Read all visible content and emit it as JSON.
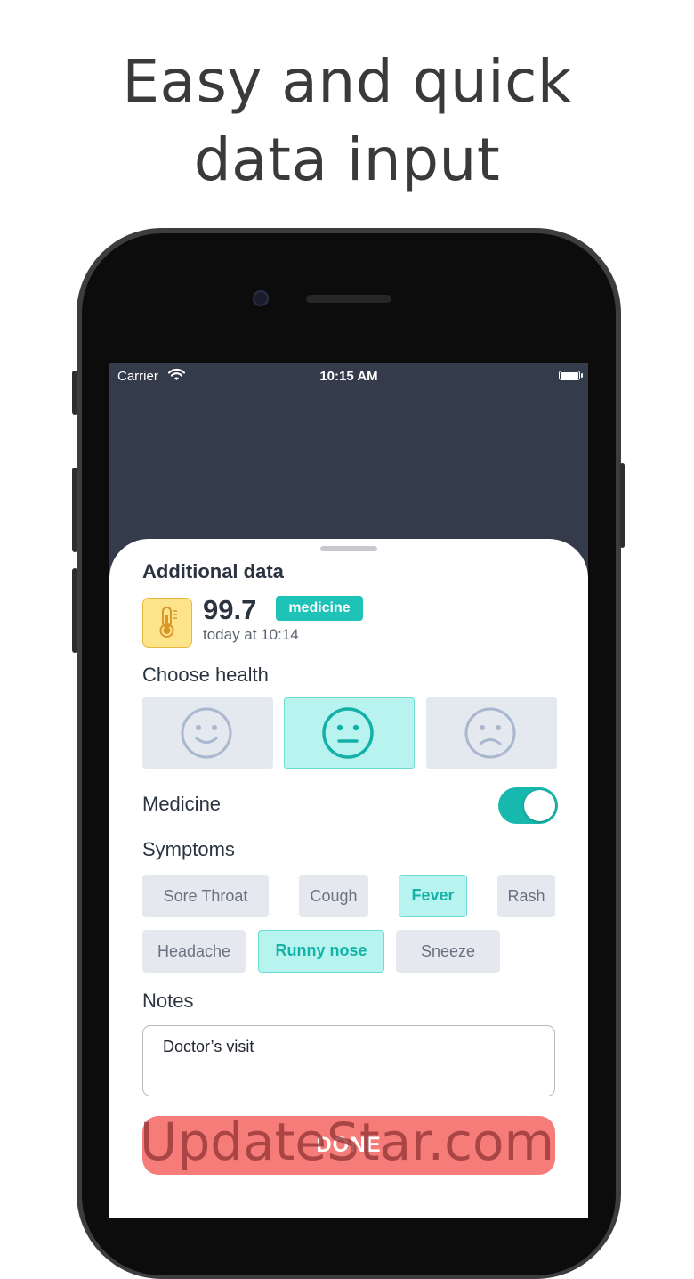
{
  "headline": {
    "line1": "Easy and quick",
    "line2": "data input"
  },
  "status_bar": {
    "carrier": "Carrier",
    "time": "10:15 AM"
  },
  "sheet": {
    "title": "Additional data",
    "reading": {
      "value": "99.7",
      "badge": "medicine",
      "timestamp": "today at 10:14",
      "icon": "thermometer-icon"
    },
    "health": {
      "label": "Choose health",
      "options": [
        {
          "name": "happy",
          "icon": "happy-face-icon",
          "selected": false
        },
        {
          "name": "neutral",
          "icon": "neutral-face-icon",
          "selected": true
        },
        {
          "name": "sad",
          "icon": "sad-face-icon",
          "selected": false
        }
      ]
    },
    "medicine": {
      "label": "Medicine",
      "on": true
    },
    "symptoms": {
      "label": "Symptoms",
      "chips": [
        {
          "label": "Sore Throat",
          "selected": false
        },
        {
          "label": "Cough",
          "selected": false
        },
        {
          "label": "Fever",
          "selected": true
        },
        {
          "label": "Rash",
          "selected": false
        },
        {
          "label": "Headache",
          "selected": false
        },
        {
          "label": "Runny nose",
          "selected": true
        },
        {
          "label": "Sneeze",
          "selected": false
        }
      ]
    },
    "notes": {
      "label": "Notes",
      "value": "Doctor’s visit"
    },
    "done_label": "DONE"
  },
  "watermark": "UpdateStar.com",
  "colors": {
    "accent": "#1fc2b7",
    "selected_bg": "#b9f3f0",
    "done_button": "#f67c79",
    "header_bg": "#343b4b",
    "thermometer_bg": "#fde38a"
  }
}
